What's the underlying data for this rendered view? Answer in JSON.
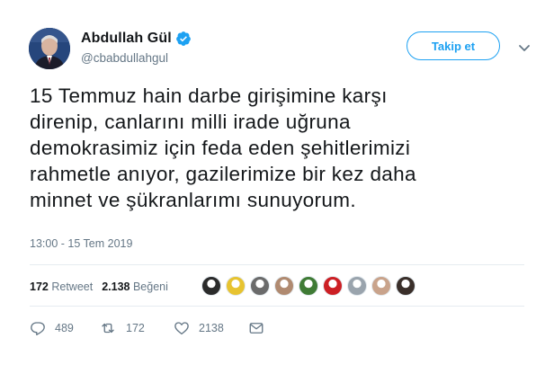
{
  "user": {
    "display_name": "Abdullah Gül",
    "handle": "@cbabdullahgul"
  },
  "follow_label": "Takip et",
  "tweet_lines": [
    "15 Temmuz hain darbe girişimine karşı",
    "direnip, canlarını milli irade uğruna",
    "demokrasimiz için feda eden şehitlerimizi",
    "rahmetle anıyor, gazilerimize bir kez daha",
    "minnet ve şükranlarımı sunuyorum."
  ],
  "timestamp": "13:00 - 15 Tem 2019",
  "stats": {
    "retweets_count": "172",
    "retweets_label": "Retweet",
    "likes_count": "2.138",
    "likes_label": "Beğeni"
  },
  "liker_avatar_colors": [
    "#2b2b2b",
    "#e7c330",
    "#6b6b6b",
    "#b08a70",
    "#3f7b35",
    "#cc1f24",
    "#9aa4ad",
    "#c9a38b",
    "#3a2f2a"
  ],
  "actions": {
    "reply_count": "489",
    "retweet_count": "172",
    "like_count": "2138"
  },
  "colors": {
    "accent": "#1da1f2",
    "text": "#14171a",
    "secondary": "#657786",
    "divider": "#e6ecf0"
  }
}
